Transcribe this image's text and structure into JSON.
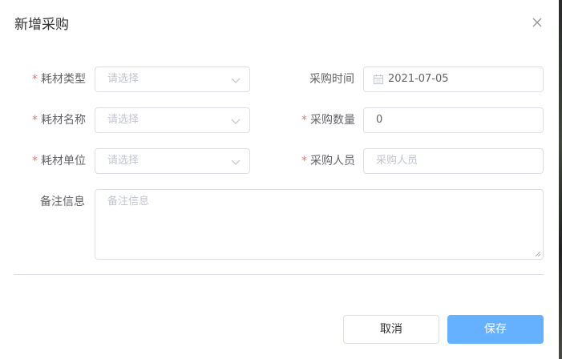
{
  "dialog": {
    "title": "新增采购"
  },
  "form": {
    "consumable_type": {
      "label": "耗材类型",
      "required": "*",
      "placeholder": "请选择"
    },
    "consumable_name": {
      "label": "耗材名称",
      "required": "*",
      "placeholder": "请选择"
    },
    "consumable_unit": {
      "label": "耗材单位",
      "required": "*",
      "placeholder": "请选择"
    },
    "purchase_time": {
      "label": "采购时间",
      "value": "2021-07-05"
    },
    "purchase_quantity": {
      "label": "采购数量",
      "required": "*",
      "value": "0"
    },
    "purchaser": {
      "label": "采购人员",
      "required": "*",
      "placeholder": "采购人员"
    },
    "remarks": {
      "label": "备注信息",
      "placeholder": "备注信息"
    }
  },
  "footer": {
    "cancel_label": "取消",
    "save_label": "保存"
  },
  "colors": {
    "required": "#f56c6c",
    "primary": "#66b1ff",
    "border": "#dcdfe6",
    "placeholder": "#c0c4cc"
  },
  "icons": {
    "close": "close-icon",
    "dropdown": "chevron-down-icon",
    "date": "calendar-icon"
  }
}
